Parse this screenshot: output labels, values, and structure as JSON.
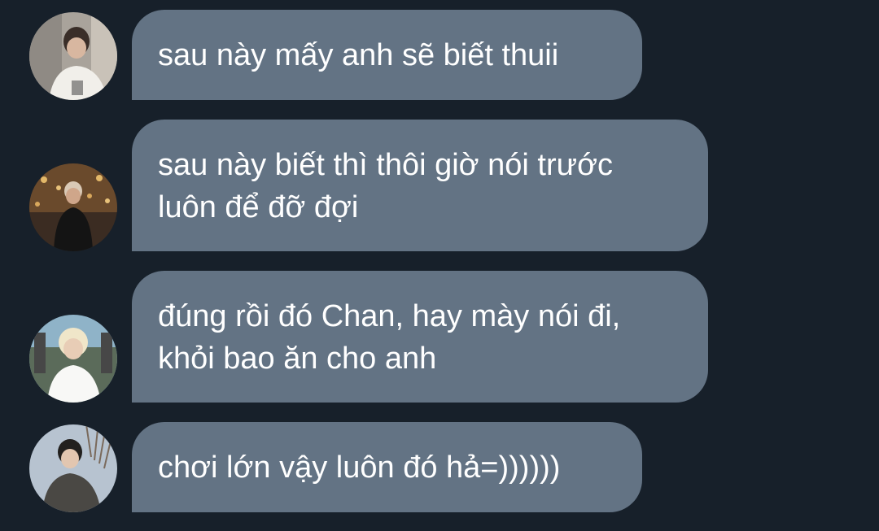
{
  "messages": [
    {
      "avatar": "avatar-photo-1",
      "lines": [
        "sau này mấy anh sẽ biết thuii"
      ]
    },
    {
      "avatar": "avatar-photo-2",
      "lines": [
        "sau này biết thì thôi giờ nói trước",
        "luôn để đỡ đợi"
      ]
    },
    {
      "avatar": "avatar-photo-3",
      "lines": [
        "đúng rồi đó Chan, hay mày nói đi,",
        "khỏi bao ăn cho anh"
      ]
    },
    {
      "avatar": "avatar-photo-4",
      "lines": [
        "chơi lớn vậy luôn đó hả=))))))"
      ]
    }
  ],
  "colors": {
    "background": "#17202a",
    "bubble": "#637384",
    "text": "#ffffff"
  }
}
